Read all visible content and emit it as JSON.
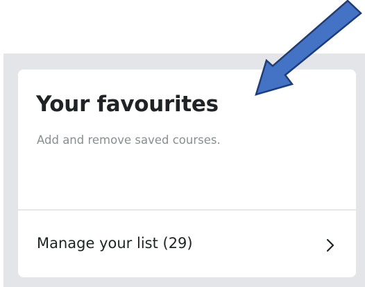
{
  "card": {
    "title": "Your favourites",
    "subtitle": "Add and remove saved courses.",
    "manage_link_label": "Manage your list (29)"
  },
  "icons": {
    "chevron": "chevron-right-icon",
    "pointer": "annotation-arrow-icon"
  },
  "colors": {
    "panel_background": "#e3e5e8",
    "card_background": "#ffffff",
    "title_text": "#1f2326",
    "subtitle_text": "#8a8d91",
    "arrow_fill": "#4472c4",
    "arrow_outline": "#1f3d79"
  }
}
